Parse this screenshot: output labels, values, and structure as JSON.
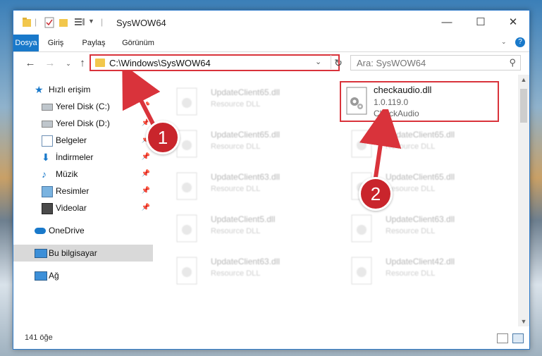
{
  "window": {
    "title": "SysWOW64"
  },
  "ribbon": {
    "tabs": [
      "Dosya",
      "Giriş",
      "Paylaş",
      "Görünüm"
    ],
    "active": "Dosya"
  },
  "nav": {
    "address": "C:\\Windows\\SysWOW64",
    "search_placeholder": "Ara: SysWOW64"
  },
  "sidebar": {
    "items": [
      {
        "label": "Hızlı erişim",
        "icon": "star-icon"
      },
      {
        "label": "Yerel Disk (C:)",
        "icon": "drive-icon"
      },
      {
        "label": "Yerel Disk (D:)",
        "icon": "drive-icon"
      },
      {
        "label": "Belgeler",
        "icon": "documents-icon"
      },
      {
        "label": "İndirmeler",
        "icon": "download-icon"
      },
      {
        "label": "Müzik",
        "icon": "music-icon"
      },
      {
        "label": "Resimler",
        "icon": "pictures-icon"
      },
      {
        "label": "Videolar",
        "icon": "video-icon"
      },
      {
        "label": "OneDrive",
        "icon": "cloud-icon"
      },
      {
        "label": "Bu bilgisayar",
        "icon": "computer-icon"
      },
      {
        "label": "Ağ",
        "icon": "network-icon"
      }
    ]
  },
  "files": {
    "left": [
      {
        "name": "UpdateClient65.dll",
        "type": "Resource DLL"
      },
      {
        "name": "UpdateClient65.dll",
        "type": "Resource DLL"
      },
      {
        "name": "UpdateClient63.dll",
        "type": "Resource DLL"
      },
      {
        "name": "UpdateClient5.dll",
        "type": "Resource DLL"
      },
      {
        "name": "UpdateClient63.dll",
        "type": "Resource DLL"
      }
    ],
    "right": [
      {
        "name": "UpdateClient65.dll",
        "type": "Resource DLL"
      },
      {
        "name": "UpdateClient65.dll",
        "type": "Resource DLL"
      },
      {
        "name": "UpdateClient63.dll",
        "type": "Resource DLL"
      },
      {
        "name": "UpdateClient42.dll",
        "type": "Resource DLL"
      }
    ],
    "highlighted": {
      "name": "checkaudio.dll",
      "version": "1.0.119.0",
      "description": "CheckAudio"
    }
  },
  "status": {
    "count": "141 öğe"
  },
  "annotations": {
    "badge1": "1",
    "badge2": "2"
  },
  "colors": {
    "accent": "#1979ca",
    "highlight": "#d9333b"
  }
}
